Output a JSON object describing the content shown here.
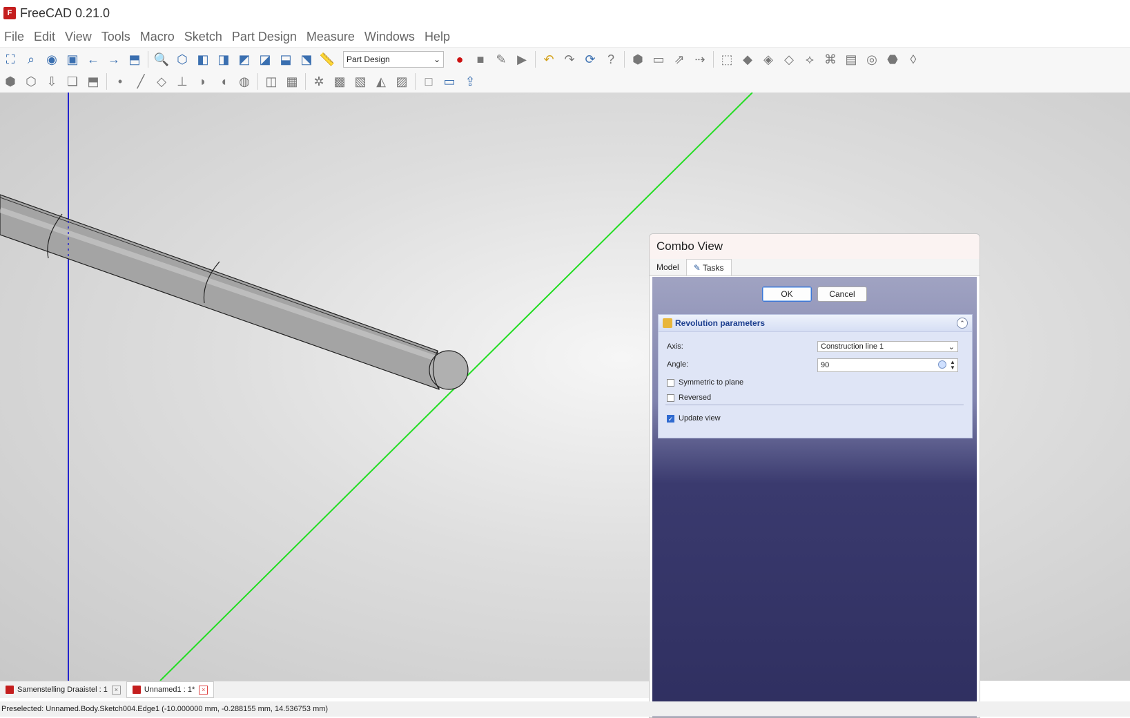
{
  "window": {
    "title": "FreeCAD 0.21.0",
    "logo_letter": "F"
  },
  "menu": [
    "File",
    "Edit",
    "View",
    "Tools",
    "Macro",
    "Sketch",
    "Part Design",
    "Measure",
    "Windows",
    "Help"
  ],
  "toolbar": {
    "workbench": "Part Design",
    "workbench_arrow": "⌄"
  },
  "combo": {
    "title": "Combo View",
    "tabs": [
      "Model",
      "Tasks"
    ],
    "ok": "OK",
    "cancel": "Cancel",
    "panel_title": "Revolution parameters",
    "axis_label": "Axis:",
    "axis_value": "Construction line 1",
    "angle_label": "Angle:",
    "angle_value": "90",
    "symmetric_label": "Symmetric to plane",
    "symmetric_checked": false,
    "reversed_label": "Reversed",
    "reversed_checked": false,
    "update_label": "Update view",
    "update_checked": true
  },
  "doc_tabs": [
    {
      "label": "Samenstelling Draaistel : 1"
    },
    {
      "label": "Unnamed1 : 1*"
    }
  ],
  "status": "Preselected: Unnamed.Body.Sketch004.Edge1 (-10.000000 mm, -0.288155 mm, 14.536753 mm)"
}
